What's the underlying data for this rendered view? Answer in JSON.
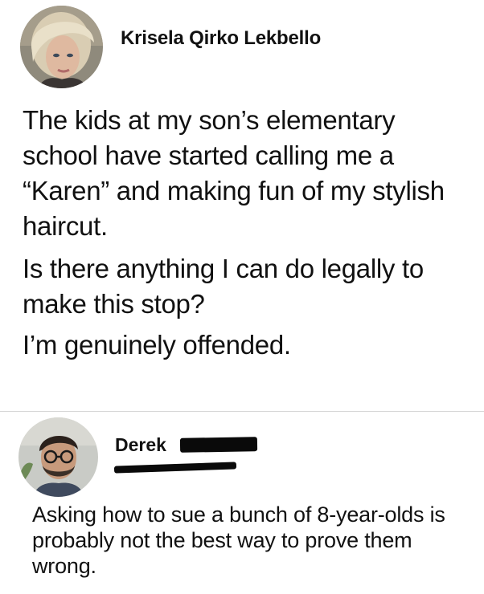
{
  "post": {
    "author": "Krisela Qirko Lekbello",
    "avatar_icon": "profile-photo",
    "paragraphs": [
      "The kids at my son’s elementary school have started calling me a “Karen” and making fun of my stylish haircut.",
      "Is there anything I can do legally to make this stop?",
      "I’m genuinely offended."
    ]
  },
  "comment": {
    "author": "Derek",
    "avatar_icon": "profile-photo",
    "text": "Asking how to sue a bunch of 8-year-olds is probably not the best way to prove them wrong."
  },
  "colors": {
    "text": "#111111",
    "divider": "#d6d6d6",
    "redaction": "#0a0a0a",
    "background": "#ffffff"
  }
}
